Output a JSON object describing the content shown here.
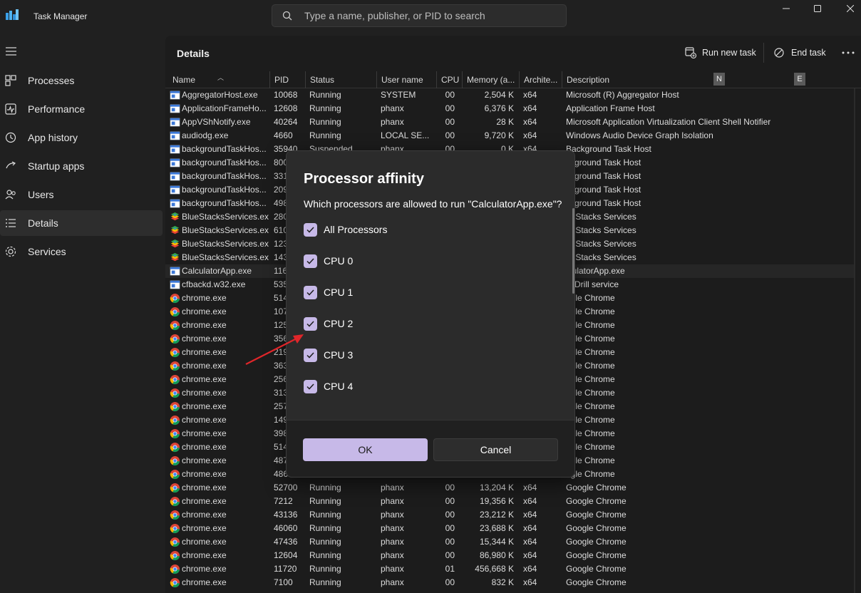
{
  "app": {
    "title": "Task Manager"
  },
  "search": {
    "placeholder": "Type a name, publisher, or PID to search"
  },
  "sidebar": {
    "items": [
      {
        "label": "Processes",
        "icon": "processes-icon"
      },
      {
        "label": "Performance",
        "icon": "performance-icon"
      },
      {
        "label": "App history",
        "icon": "app-history-icon"
      },
      {
        "label": "Startup apps",
        "icon": "startup-apps-icon"
      },
      {
        "label": "Users",
        "icon": "users-icon"
      },
      {
        "label": "Details",
        "icon": "details-icon",
        "active": true
      },
      {
        "label": "Services",
        "icon": "services-icon"
      }
    ]
  },
  "header": {
    "title": "Details",
    "run_new_task": "Run new task",
    "end_task": "End task"
  },
  "table": {
    "columns": [
      "Name",
      "PID",
      "Status",
      "User name",
      "CPU",
      "Memory (a...",
      "Archite...",
      "Description"
    ],
    "badges": [
      "N",
      "E"
    ],
    "rows": [
      {
        "icon": "app",
        "name": "AggregatorHost.exe",
        "pid": "10068",
        "status": "Running",
        "user": "SYSTEM",
        "cpu": "00",
        "mem": "2,504 K",
        "arch": "x64",
        "desc": "Microsoft (R) Aggregator Host"
      },
      {
        "icon": "app",
        "name": "ApplicationFrameHo...",
        "pid": "12608",
        "status": "Running",
        "user": "phanx",
        "cpu": "00",
        "mem": "6,376 K",
        "arch": "x64",
        "desc": "Application Frame Host"
      },
      {
        "icon": "app",
        "name": "AppVShNotify.exe",
        "pid": "40264",
        "status": "Running",
        "user": "phanx",
        "cpu": "00",
        "mem": "28 K",
        "arch": "x64",
        "desc": "Microsoft Application Virtualization Client Shell Notifier"
      },
      {
        "icon": "app",
        "name": "audiodg.exe",
        "pid": "4660",
        "status": "Running",
        "user": "LOCAL SE...",
        "cpu": "00",
        "mem": "9,720 K",
        "arch": "x64",
        "desc": "Windows Audio Device Graph Isolation"
      },
      {
        "icon": "app",
        "name": "backgroundTaskHos...",
        "pid": "35940",
        "status": "Suspended",
        "user": "phanx",
        "cpu": "00",
        "mem": "0 K",
        "arch": "x64",
        "desc": "Background Task Host"
      },
      {
        "icon": "app",
        "name": "backgroundTaskHos...",
        "pid": "800",
        "status": "",
        "user": "",
        "cpu": "",
        "mem": "",
        "arch": "",
        "desc": "ckground Task Host"
      },
      {
        "icon": "app",
        "name": "backgroundTaskHos...",
        "pid": "331",
        "status": "",
        "user": "",
        "cpu": "",
        "mem": "",
        "arch": "",
        "desc": "ckground Task Host"
      },
      {
        "icon": "app",
        "name": "backgroundTaskHos...",
        "pid": "209",
        "status": "",
        "user": "",
        "cpu": "",
        "mem": "",
        "arch": "",
        "desc": "ckground Task Host"
      },
      {
        "icon": "app",
        "name": "backgroundTaskHos...",
        "pid": "498",
        "status": "",
        "user": "",
        "cpu": "",
        "mem": "",
        "arch": "",
        "desc": "ckground Task Host"
      },
      {
        "icon": "bluestacks",
        "name": "BlueStacksServices.exe",
        "pid": "280",
        "status": "",
        "user": "",
        "cpu": "",
        "mem": "",
        "arch": "",
        "desc": "ueStacks Services"
      },
      {
        "icon": "bluestacks",
        "name": "BlueStacksServices.exe",
        "pid": "610",
        "status": "",
        "user": "",
        "cpu": "",
        "mem": "",
        "arch": "",
        "desc": "ueStacks Services"
      },
      {
        "icon": "bluestacks",
        "name": "BlueStacksServices.exe",
        "pid": "123",
        "status": "",
        "user": "",
        "cpu": "",
        "mem": "",
        "arch": "",
        "desc": "ueStacks Services"
      },
      {
        "icon": "bluestacks",
        "name": "BlueStacksServices.exe",
        "pid": "143",
        "status": "",
        "user": "",
        "cpu": "",
        "mem": "",
        "arch": "",
        "desc": "ueStacks Services"
      },
      {
        "icon": "app",
        "name": "CalculatorApp.exe",
        "pid": "116",
        "status": "",
        "user": "",
        "cpu": "",
        "mem": "",
        "arch": "",
        "desc": "lculatorApp.exe",
        "selected": true
      },
      {
        "icon": "app",
        "name": "cfbackd.w32.exe",
        "pid": "535",
        "status": "",
        "user": "",
        "cpu": "",
        "mem": "",
        "arch": "",
        "desc": "skDrill service"
      },
      {
        "icon": "chrome",
        "name": "chrome.exe",
        "pid": "514",
        "status": "",
        "user": "",
        "cpu": "",
        "mem": "",
        "arch": "",
        "desc": "ogle Chrome"
      },
      {
        "icon": "chrome",
        "name": "chrome.exe",
        "pid": "107",
        "status": "",
        "user": "",
        "cpu": "",
        "mem": "",
        "arch": "",
        "desc": "ogle Chrome"
      },
      {
        "icon": "chrome",
        "name": "chrome.exe",
        "pid": "125",
        "status": "",
        "user": "",
        "cpu": "",
        "mem": "",
        "arch": "",
        "desc": "ogle Chrome"
      },
      {
        "icon": "chrome",
        "name": "chrome.exe",
        "pid": "356",
        "status": "",
        "user": "",
        "cpu": "",
        "mem": "",
        "arch": "",
        "desc": "ogle Chrome"
      },
      {
        "icon": "chrome",
        "name": "chrome.exe",
        "pid": "219",
        "status": "",
        "user": "",
        "cpu": "",
        "mem": "",
        "arch": "",
        "desc": "ogle Chrome"
      },
      {
        "icon": "chrome",
        "name": "chrome.exe",
        "pid": "363",
        "status": "",
        "user": "",
        "cpu": "",
        "mem": "",
        "arch": "",
        "desc": "ogle Chrome"
      },
      {
        "icon": "chrome",
        "name": "chrome.exe",
        "pid": "256",
        "status": "",
        "user": "",
        "cpu": "",
        "mem": "",
        "arch": "",
        "desc": "ogle Chrome"
      },
      {
        "icon": "chrome",
        "name": "chrome.exe",
        "pid": "313",
        "status": "",
        "user": "",
        "cpu": "",
        "mem": "",
        "arch": "",
        "desc": "ogle Chrome"
      },
      {
        "icon": "chrome",
        "name": "chrome.exe",
        "pid": "257",
        "status": "",
        "user": "",
        "cpu": "",
        "mem": "",
        "arch": "",
        "desc": "ogle Chrome"
      },
      {
        "icon": "chrome",
        "name": "chrome.exe",
        "pid": "149",
        "status": "",
        "user": "",
        "cpu": "",
        "mem": "",
        "arch": "",
        "desc": "ogle Chrome"
      },
      {
        "icon": "chrome",
        "name": "chrome.exe",
        "pid": "398",
        "status": "",
        "user": "",
        "cpu": "",
        "mem": "",
        "arch": "",
        "desc": "ogle Chrome"
      },
      {
        "icon": "chrome",
        "name": "chrome.exe",
        "pid": "514",
        "status": "",
        "user": "",
        "cpu": "",
        "mem": "",
        "arch": "",
        "desc": "ogle Chrome"
      },
      {
        "icon": "chrome",
        "name": "chrome.exe",
        "pid": "487",
        "status": "",
        "user": "",
        "cpu": "",
        "mem": "",
        "arch": "",
        "desc": "ogle Chrome"
      },
      {
        "icon": "chrome",
        "name": "chrome.exe",
        "pid": "486",
        "status": "",
        "user": "",
        "cpu": "",
        "mem": "",
        "arch": "",
        "desc": "ogle Chrome"
      },
      {
        "icon": "chrome",
        "name": "chrome.exe",
        "pid": "52700",
        "status": "Running",
        "user": "phanx",
        "cpu": "00",
        "mem": "13,204 K",
        "arch": "x64",
        "desc": "Google Chrome"
      },
      {
        "icon": "chrome",
        "name": "chrome.exe",
        "pid": "7212",
        "status": "Running",
        "user": "phanx",
        "cpu": "00",
        "mem": "19,356 K",
        "arch": "x64",
        "desc": "Google Chrome"
      },
      {
        "icon": "chrome",
        "name": "chrome.exe",
        "pid": "43136",
        "status": "Running",
        "user": "phanx",
        "cpu": "00",
        "mem": "23,212 K",
        "arch": "x64",
        "desc": "Google Chrome"
      },
      {
        "icon": "chrome",
        "name": "chrome.exe",
        "pid": "46060",
        "status": "Running",
        "user": "phanx",
        "cpu": "00",
        "mem": "23,688 K",
        "arch": "x64",
        "desc": "Google Chrome"
      },
      {
        "icon": "chrome",
        "name": "chrome.exe",
        "pid": "47436",
        "status": "Running",
        "user": "phanx",
        "cpu": "00",
        "mem": "15,344 K",
        "arch": "x64",
        "desc": "Google Chrome"
      },
      {
        "icon": "chrome",
        "name": "chrome.exe",
        "pid": "12604",
        "status": "Running",
        "user": "phanx",
        "cpu": "00",
        "mem": "86,980 K",
        "arch": "x64",
        "desc": "Google Chrome"
      },
      {
        "icon": "chrome",
        "name": "chrome.exe",
        "pid": "11720",
        "status": "Running",
        "user": "phanx",
        "cpu": "01",
        "mem": "456,668 K",
        "arch": "x64",
        "desc": "Google Chrome"
      },
      {
        "icon": "chrome",
        "name": "chrome.exe",
        "pid": "7100",
        "status": "Running",
        "user": "phanx",
        "cpu": "00",
        "mem": "832 K",
        "arch": "x64",
        "desc": "Google Chrome"
      }
    ]
  },
  "dialog": {
    "title": "Processor affinity",
    "message": "Which processors are allowed to run \"CalculatorApp.exe\"?",
    "options": [
      {
        "label": "All Processors",
        "checked": true
      },
      {
        "label": "CPU 0",
        "checked": true
      },
      {
        "label": "CPU 1",
        "checked": true
      },
      {
        "label": "CPU 2",
        "checked": true
      },
      {
        "label": "CPU 3",
        "checked": true
      },
      {
        "label": "CPU 4",
        "checked": true
      }
    ],
    "ok_label": "OK",
    "cancel_label": "Cancel"
  },
  "colors": {
    "accent": "#c7b9e8",
    "annotation_arrow": "#e0262a",
    "background": "#202020"
  }
}
